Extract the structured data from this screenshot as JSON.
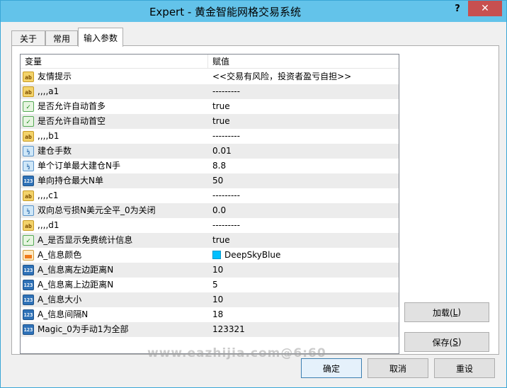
{
  "window": {
    "title": "Expert - 黄金智能网格交易系统",
    "help": "?",
    "close": "✕"
  },
  "tabs": [
    {
      "label": "关于"
    },
    {
      "label": "常用"
    },
    {
      "label": "输入参数"
    }
  ],
  "grid": {
    "headers": {
      "variable": "变量",
      "value": "赋值"
    },
    "rows": [
      {
        "icon": "ab",
        "name": "友情提示",
        "value": "<<交易有风险，投资者盈亏自担>>"
      },
      {
        "icon": "ab",
        "name": ",,,,a1",
        "value": "---------"
      },
      {
        "icon": "bool",
        "name": "是否允许自动首多",
        "value": "true"
      },
      {
        "icon": "bool",
        "name": "是否允许自动首空",
        "value": "true"
      },
      {
        "icon": "ab",
        "name": ",,,,b1",
        "value": "---------"
      },
      {
        "icon": "dbl",
        "name": "建仓手数",
        "value": "0.01"
      },
      {
        "icon": "dbl",
        "name": "单个订单最大建仓N手",
        "value": "8.8"
      },
      {
        "icon": "int",
        "name": "单向持仓最大N单",
        "value": "50"
      },
      {
        "icon": "ab",
        "name": ",,,,c1",
        "value": "---------"
      },
      {
        "icon": "dbl",
        "name": "双向总亏损N美元全平_0为关闭",
        "value": "0.0"
      },
      {
        "icon": "ab",
        "name": ",,,,d1",
        "value": "---------"
      },
      {
        "icon": "bool",
        "name": "A_是否显示免费统计信息",
        "value": "true"
      },
      {
        "icon": "color",
        "name": "A_信息颜色",
        "value": "DeepSkyBlue",
        "swatch": "#00bfff"
      },
      {
        "icon": "int",
        "name": "A_信息离左边距离N",
        "value": "10"
      },
      {
        "icon": "int",
        "name": "A_信息离上边距离N",
        "value": "5"
      },
      {
        "icon": "int",
        "name": "A_信息大小",
        "value": "10"
      },
      {
        "icon": "int",
        "name": "A_信息间隔N",
        "value": "18"
      },
      {
        "icon": "int",
        "name": "Magic_0为手动1为全部",
        "value": "123321"
      }
    ]
  },
  "icons": {
    "ab": "ab",
    "bool": "✓",
    "dbl": "½",
    "int": "123"
  },
  "watermark": "www.eazhijia.com@6:60",
  "buttons": {
    "load": {
      "label": "加载(",
      "key": "L",
      "suffix": ")"
    },
    "save": {
      "label": "保存(",
      "key": "S",
      "suffix": ")"
    },
    "ok": "确定",
    "cancel": "取消",
    "reset": "重设"
  }
}
